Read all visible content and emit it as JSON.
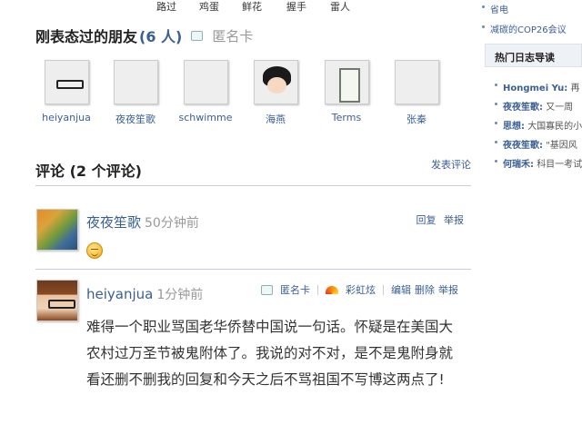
{
  "reactions": [
    "路过",
    "鸡蛋",
    "鲜花",
    "握手",
    "雷人"
  ],
  "friends": {
    "title": "刚表态过的朋友",
    "count_text": "(6 人)",
    "anon_card": "匿名卡",
    "items": [
      {
        "name": "heiyanjua"
      },
      {
        "name": "夜夜笙歌"
      },
      {
        "name": "schwimme"
      },
      {
        "name": "海燕"
      },
      {
        "name": "Terms"
      },
      {
        "name": "张秦"
      }
    ]
  },
  "comments": {
    "title": "评论 (2 个评论)",
    "post_link": "发表评论",
    "items": [
      {
        "author": "夜夜笙歌",
        "time": "50分钟前",
        "actions": [
          "回复",
          "举报"
        ]
      },
      {
        "author": "heiyanjua",
        "time": "1分钟前",
        "anon_card": "匿名卡",
        "rainbow": "彩虹炫",
        "actions": [
          "编辑",
          "删除",
          "举报"
        ],
        "body": "难得一个职业骂国老华侨替中国说一句话。怀疑是在美国大农村过万圣节被鬼附体了。我说的对不对，是不是鬼附身就看还删不删我的回复和今天之后不骂祖国不写博这两点了!"
      }
    ]
  },
  "sidebar": {
    "top_items": [
      "省电",
      "减碳的COP26会议"
    ],
    "hot_title": "热门日志导读",
    "blogs": [
      {
        "author": "Hongmei Yu:",
        "text": "再"
      },
      {
        "author": "夜夜笙歌:",
        "text": "又一周"
      },
      {
        "author": "思想:",
        "text": "大国寡民的小"
      },
      {
        "author": "夜夜笙歌:",
        "text": "\"基因风"
      },
      {
        "author": "何瑞禾:",
        "text": "科目一考试"
      }
    ]
  }
}
